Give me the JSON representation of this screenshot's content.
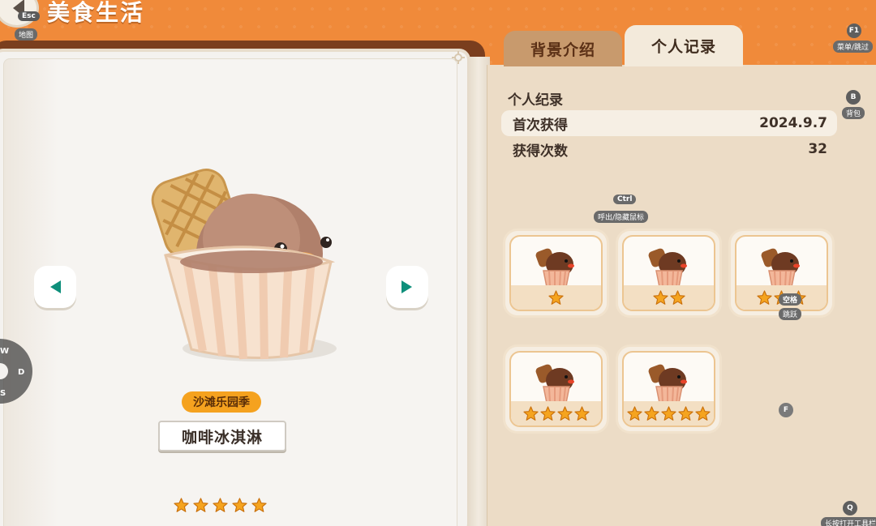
{
  "header": {
    "title": "美食生活",
    "esc_key": "Esc",
    "map_label": "地图"
  },
  "hints": {
    "f1_key": "F1",
    "f1_label": "菜单/跳过",
    "b_key": "B",
    "b_label": "背包",
    "ctrl_key": "Ctrl",
    "ctrl_label": "呼出/隐藏鼠标",
    "space_key": "空格",
    "space_label": "跳跃",
    "f_key": "F",
    "q_key": "Q",
    "q_label": "长按打开工具栏"
  },
  "tabs": [
    {
      "label": "背景介绍",
      "active": false
    },
    {
      "label": "个人记录",
      "active": true
    }
  ],
  "record": {
    "title": "个人纪录",
    "rows": [
      {
        "label": "首次获得",
        "value": "2024.9.7"
      },
      {
        "label": "获得次数",
        "value": "32"
      }
    ]
  },
  "variants": [
    {
      "stars": 1
    },
    {
      "stars": 2
    },
    {
      "stars": 3
    },
    {
      "stars": 4
    },
    {
      "stars": 5
    }
  ],
  "item": {
    "season": "沙滩乐园季",
    "name": "咖啡冰淇淋",
    "rating": 5
  },
  "dpad": {
    "up": "W",
    "right": "D",
    "down": "S"
  },
  "colors": {
    "background": "#f08a3a",
    "star": "#f5a41f",
    "tab_active": "#f3eadb",
    "tab_inactive": "#c89a6d"
  }
}
